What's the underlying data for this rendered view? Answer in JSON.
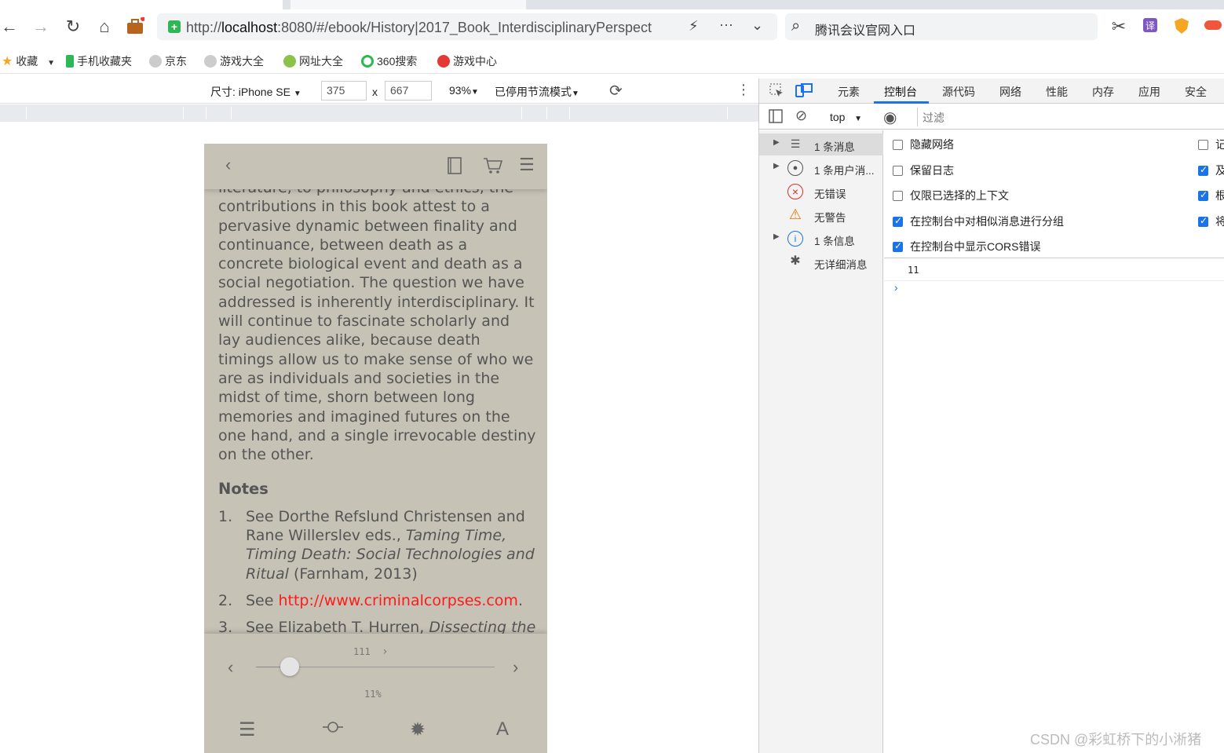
{
  "browser": {
    "url_prefix": "http://",
    "url_host": "localhost",
    "url_rest": ":8080/#/ebook/History|2017_Book_InterdisciplinaryPerspect",
    "search_text": "腾讯会议官网入口",
    "bookmarks": [
      "收藏",
      "手机收藏夹",
      "京东",
      "游戏大全",
      "网址大全",
      "360搜索",
      "游戏中心"
    ]
  },
  "device_toolbar": {
    "size_label": "尺寸: iPhone SE",
    "width": "375",
    "height": "667",
    "times": "x",
    "zoom": "93%",
    "throttle": "已停用节流模式"
  },
  "reader": {
    "paragraph": "literature, to philosophy and ethics, the contributions in this book attest to a pervasive dynamic between finality and continuance, between death as a concrete biological event and death as a social negotiation. The question we have addressed is inherently interdisciplinary. It will continue to fascinate scholarly and lay audiences alike, because death timings allow us to make sense of who we are as individuals and societies in the midst of time, shorn between long memories and imagined futures on the one hand, and a single irrevocable destiny on the other.",
    "notes_title": "Notes",
    "notes": [
      {
        "num": "1.",
        "pre": "See Dorthe Refslund Christensen and Rane Willerslev eds., ",
        "italic": "Taming Time, Timing Death: Social Technologies and Ritual",
        "post": " (Farnham, 2013)"
      },
      {
        "num": "2.",
        "pre": "See ",
        "link": "http://www.criminalcorpses.com",
        "post": "."
      },
      {
        "num": "3.",
        "pre": "See Elizabeth T. Hurren, ",
        "italic": "Dissecting the Criminal Corpse: Staging Post-Execution",
        "post": ""
      }
    ],
    "page_label": "111",
    "progress_label": "11%",
    "progress": 0.14
  },
  "devtools": {
    "tabs": [
      "元素",
      "控制台",
      "源代码",
      "网络",
      "性能",
      "内存",
      "应用",
      "安全"
    ],
    "context": "top",
    "filter_placeholder": "过滤",
    "sidebar": [
      {
        "label": "1 条消息",
        "icon": "list-icon"
      },
      {
        "label": "1 条用户消...",
        "icon": "user-icon"
      },
      {
        "label": "无错误",
        "icon": "error-icon"
      },
      {
        "label": "无警告",
        "icon": "warning-icon"
      },
      {
        "label": "1 条信息",
        "icon": "info-icon"
      },
      {
        "label": "无详细消息",
        "icon": "bug-icon"
      }
    ],
    "settings_left": [
      {
        "label": "隐藏网络",
        "checked": false
      },
      {
        "label": "保留日志",
        "checked": false
      },
      {
        "label": "仅限已选择的上下文",
        "checked": false
      },
      {
        "label": "在控制台中对相似消息进行分组",
        "checked": true
      },
      {
        "label": "在控制台中显示CORS错误",
        "checked": true
      }
    ],
    "settings_right": [
      "记",
      "及",
      "根",
      "将"
    ],
    "console_value": "11"
  },
  "watermark": "CSDN @彩虹桥下的小淅猪"
}
